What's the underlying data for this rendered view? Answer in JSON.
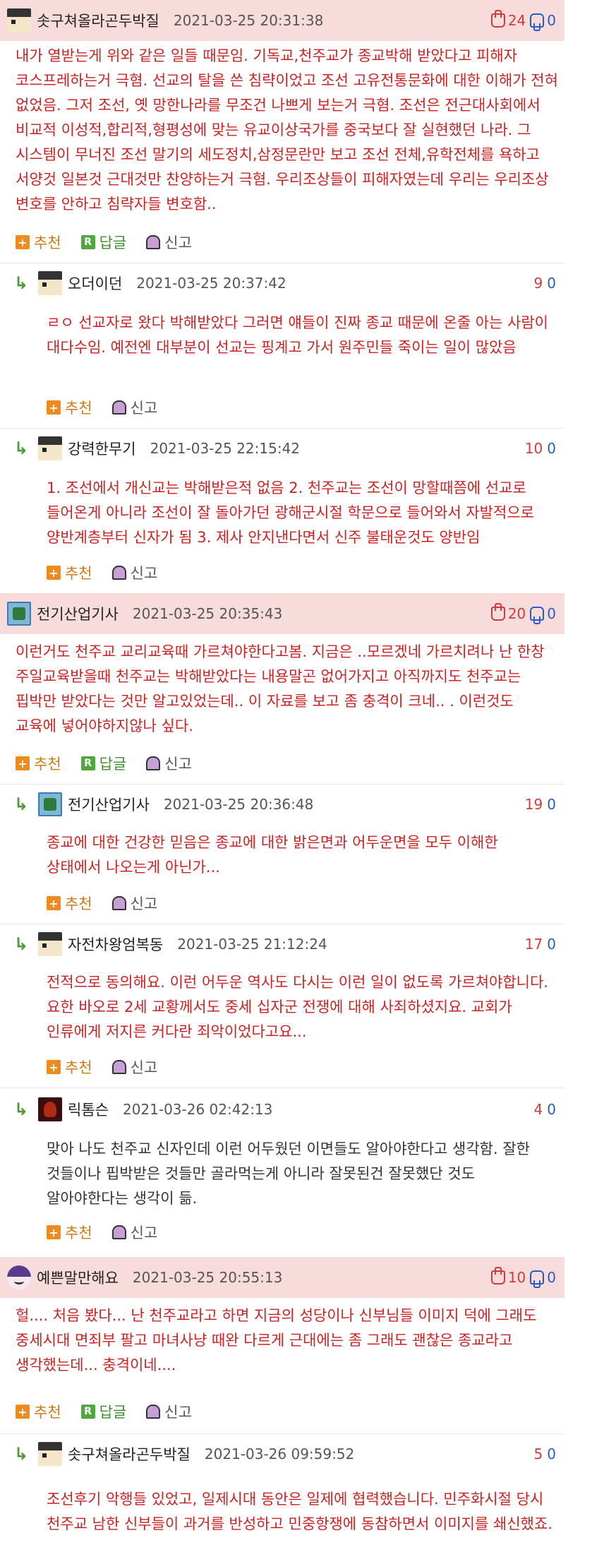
{
  "icons": {
    "thumbs_up": "thumbs-up-icon",
    "thumbs_down": "thumbs-down-icon",
    "recommend": "plus-icon",
    "reply": "reply-r-icon",
    "report": "report-bell-icon",
    "reply_arrow": "reply-arrow-icon"
  },
  "actions": {
    "recommend": "추천",
    "reply": "답글",
    "report": "신고"
  },
  "reply_arrow": "↳",
  "comments": [
    {
      "nick": "솟구쳐올라곤두박질",
      "date": "2021-03-25 20:31:38",
      "up": "24",
      "down": "0",
      "text": "내가 열받는게 위와 같은 일들 때문임. 기독교,천주교가 종교박해 받았다고 피해자 코스프레하는거 극혐. 선교의 탈을 쓴 침략이었고 조선 고유전통문화에 대한 이해가 전혀 없었음. 그저 조선, 옛 망한나라를 무조건 나쁘게 보는거 극혐. 조선은 전근대사회에서 비교적 이성적,합리적,형평성에 맞는 유교이상국가를 중국보다 잘 실현했던 나라. 그 시스템이 무너진 조선 말기의 세도정치,삼정문란만 보고 조선 전체,유학전체를 욕하고 서양것 일본것 근대것만 찬양하는거 극혐. 우리조상들이 피해자였는데 우리는 우리조상 변호를 안하고 침략자들 변호함..",
      "replies": [
        {
          "nick": "오더이던",
          "date": "2021-03-25 20:37:42",
          "up": "9",
          "down": "0",
          "text": "ㄹㅇ 선교자로 왔다 박해받았다 그러면 얘들이 진짜 종교 때문에 온줄 아는 사람이 대다수임. 예전엔 대부분이 선교는 핑계고 가서 원주민들 죽이는 일이 많았음"
        },
        {
          "nick": "강력한무기",
          "date": "2021-03-25 22:15:42",
          "up": "10",
          "down": "0",
          "text": "1. 조선에서 개신교는 박해받은적 없음 2. 천주교는 조선이 망할때쯤에 선교로 들어온게 아니라 조선이 잘 돌아가던 광해군시절 학문으로 들어와서 자발적으로 양반계층부터 신자가 됨 3. 제사 안지낸다면서 신주 불태운것도 양반임"
        }
      ]
    },
    {
      "nick": "전기산업기사",
      "date": "2021-03-25 20:35:43",
      "up": "20",
      "down": "0",
      "text": "이런거도 천주교 교리교육때 가르쳐야한다고봄. 지금은 ..모르겠네 가르치려나 난 한창 주일교육받을때 천주교는 박해받았다는 내용말곤 없어가지고 아직까지도 천주교는 핍박만 받았다는 것만 알고있었는데.. 이 자료를 보고 좀 충격이 크네.. . 이런것도 교육에 넣어야하지않나 싶다.",
      "replies": [
        {
          "nick": "전기산업기사",
          "date": "2021-03-25 20:36:48",
          "up": "19",
          "down": "0",
          "text": "종교에 대한 건강한 믿음은 종교에 대한 밝은면과 어두운면을 모두 이해한 상태에서 나오는게 아닌가..."
        },
        {
          "nick": "자전차왕엄복동",
          "date": "2021-03-25 21:12:24",
          "up": "17",
          "down": "0",
          "text": "전적으로 동의해요. 이런 어두운 역사도 다시는 이런 일이 없도록 가르쳐야합니다. 요한 바오로 2세 교황께서도 중세 십자군 전쟁에 대해 사죄하셨지요. 교회가 인류에게 저지른 커다란 죄악이었다고요..."
        },
        {
          "nick": "릭톰슨",
          "date": "2021-03-26 02:42:13",
          "up": "4",
          "down": "0",
          "text": "맞아 나도 천주교 신자인데 이런 어두웠던 이면들도 알아야한다고 생각함. 잘한 것들이나 핍박받은 것들만 골라먹는게 아니라 잘못된건 잘못했단 것도 알아야한다는 생각이 듦."
        }
      ]
    },
    {
      "nick": "예쁜말만해요",
      "date": "2021-03-25 20:55:13",
      "up": "10",
      "down": "0",
      "text": "헐.... 처음 봤다... 난 천주교라고 하면 지금의 성당이나 신부님들 이미지 덕에 그래도 중세시대 면죄부 팔고 마녀사냥 때완 다르게 근대에는 좀 그래도 괜찮은 종교라고 생각했는데... 충격이네....",
      "replies": [
        {
          "nick": "솟구쳐올라곤두박질",
          "date": "2021-03-26 09:59:52",
          "up": "5",
          "down": "0",
          "text": "조선후기 악행들 있었고, 일제시대 동안은 일제에 협력했습니다. 민주화시절 당시 천주교 남한 신부들이 과거를 반성하고 민중항쟁에 동참하면서 이미지를 쇄신했죠."
        }
      ]
    }
  ]
}
